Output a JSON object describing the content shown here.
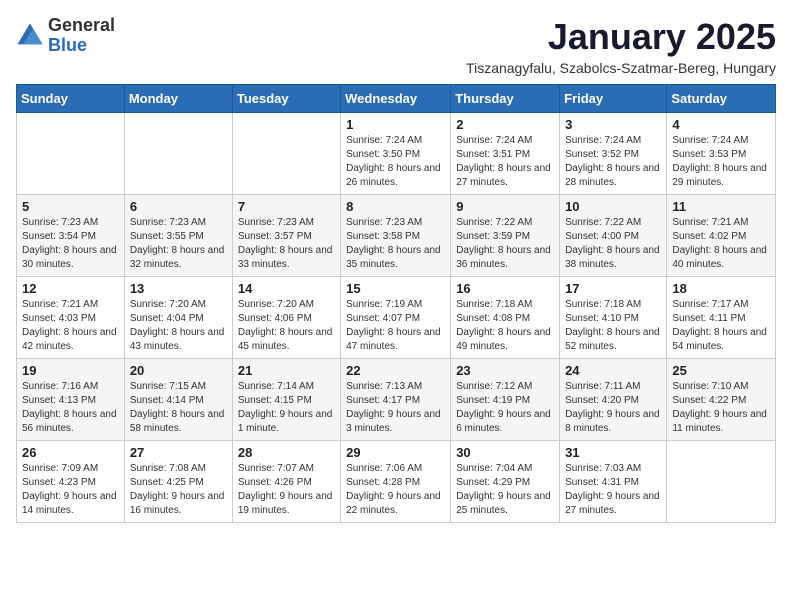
{
  "header": {
    "logo_general": "General",
    "logo_blue": "Blue",
    "month_title": "January 2025",
    "subtitle": "Tiszanagyfalu, Szabolcs-Szatmar-Bereg, Hungary"
  },
  "weekdays": [
    "Sunday",
    "Monday",
    "Tuesday",
    "Wednesday",
    "Thursday",
    "Friday",
    "Saturday"
  ],
  "weeks": [
    [
      {
        "day": null
      },
      {
        "day": null
      },
      {
        "day": null
      },
      {
        "day": 1,
        "sunrise": "Sunrise: 7:24 AM",
        "sunset": "Sunset: 3:50 PM",
        "daylight": "Daylight: 8 hours and 26 minutes."
      },
      {
        "day": 2,
        "sunrise": "Sunrise: 7:24 AM",
        "sunset": "Sunset: 3:51 PM",
        "daylight": "Daylight: 8 hours and 27 minutes."
      },
      {
        "day": 3,
        "sunrise": "Sunrise: 7:24 AM",
        "sunset": "Sunset: 3:52 PM",
        "daylight": "Daylight: 8 hours and 28 minutes."
      },
      {
        "day": 4,
        "sunrise": "Sunrise: 7:24 AM",
        "sunset": "Sunset: 3:53 PM",
        "daylight": "Daylight: 8 hours and 29 minutes."
      }
    ],
    [
      {
        "day": 5,
        "sunrise": "Sunrise: 7:23 AM",
        "sunset": "Sunset: 3:54 PM",
        "daylight": "Daylight: 8 hours and 30 minutes."
      },
      {
        "day": 6,
        "sunrise": "Sunrise: 7:23 AM",
        "sunset": "Sunset: 3:55 PM",
        "daylight": "Daylight: 8 hours and 32 minutes."
      },
      {
        "day": 7,
        "sunrise": "Sunrise: 7:23 AM",
        "sunset": "Sunset: 3:57 PM",
        "daylight": "Daylight: 8 hours and 33 minutes."
      },
      {
        "day": 8,
        "sunrise": "Sunrise: 7:23 AM",
        "sunset": "Sunset: 3:58 PM",
        "daylight": "Daylight: 8 hours and 35 minutes."
      },
      {
        "day": 9,
        "sunrise": "Sunrise: 7:22 AM",
        "sunset": "Sunset: 3:59 PM",
        "daylight": "Daylight: 8 hours and 36 minutes."
      },
      {
        "day": 10,
        "sunrise": "Sunrise: 7:22 AM",
        "sunset": "Sunset: 4:00 PM",
        "daylight": "Daylight: 8 hours and 38 minutes."
      },
      {
        "day": 11,
        "sunrise": "Sunrise: 7:21 AM",
        "sunset": "Sunset: 4:02 PM",
        "daylight": "Daylight: 8 hours and 40 minutes."
      }
    ],
    [
      {
        "day": 12,
        "sunrise": "Sunrise: 7:21 AM",
        "sunset": "Sunset: 4:03 PM",
        "daylight": "Daylight: 8 hours and 42 minutes."
      },
      {
        "day": 13,
        "sunrise": "Sunrise: 7:20 AM",
        "sunset": "Sunset: 4:04 PM",
        "daylight": "Daylight: 8 hours and 43 minutes."
      },
      {
        "day": 14,
        "sunrise": "Sunrise: 7:20 AM",
        "sunset": "Sunset: 4:06 PM",
        "daylight": "Daylight: 8 hours and 45 minutes."
      },
      {
        "day": 15,
        "sunrise": "Sunrise: 7:19 AM",
        "sunset": "Sunset: 4:07 PM",
        "daylight": "Daylight: 8 hours and 47 minutes."
      },
      {
        "day": 16,
        "sunrise": "Sunrise: 7:18 AM",
        "sunset": "Sunset: 4:08 PM",
        "daylight": "Daylight: 8 hours and 49 minutes."
      },
      {
        "day": 17,
        "sunrise": "Sunrise: 7:18 AM",
        "sunset": "Sunset: 4:10 PM",
        "daylight": "Daylight: 8 hours and 52 minutes."
      },
      {
        "day": 18,
        "sunrise": "Sunrise: 7:17 AM",
        "sunset": "Sunset: 4:11 PM",
        "daylight": "Daylight: 8 hours and 54 minutes."
      }
    ],
    [
      {
        "day": 19,
        "sunrise": "Sunrise: 7:16 AM",
        "sunset": "Sunset: 4:13 PM",
        "daylight": "Daylight: 8 hours and 56 minutes."
      },
      {
        "day": 20,
        "sunrise": "Sunrise: 7:15 AM",
        "sunset": "Sunset: 4:14 PM",
        "daylight": "Daylight: 8 hours and 58 minutes."
      },
      {
        "day": 21,
        "sunrise": "Sunrise: 7:14 AM",
        "sunset": "Sunset: 4:15 PM",
        "daylight": "Daylight: 9 hours and 1 minute."
      },
      {
        "day": 22,
        "sunrise": "Sunrise: 7:13 AM",
        "sunset": "Sunset: 4:17 PM",
        "daylight": "Daylight: 9 hours and 3 minutes."
      },
      {
        "day": 23,
        "sunrise": "Sunrise: 7:12 AM",
        "sunset": "Sunset: 4:19 PM",
        "daylight": "Daylight: 9 hours and 6 minutes."
      },
      {
        "day": 24,
        "sunrise": "Sunrise: 7:11 AM",
        "sunset": "Sunset: 4:20 PM",
        "daylight": "Daylight: 9 hours and 8 minutes."
      },
      {
        "day": 25,
        "sunrise": "Sunrise: 7:10 AM",
        "sunset": "Sunset: 4:22 PM",
        "daylight": "Daylight: 9 hours and 11 minutes."
      }
    ],
    [
      {
        "day": 26,
        "sunrise": "Sunrise: 7:09 AM",
        "sunset": "Sunset: 4:23 PM",
        "daylight": "Daylight: 9 hours and 14 minutes."
      },
      {
        "day": 27,
        "sunrise": "Sunrise: 7:08 AM",
        "sunset": "Sunset: 4:25 PM",
        "daylight": "Daylight: 9 hours and 16 minutes."
      },
      {
        "day": 28,
        "sunrise": "Sunrise: 7:07 AM",
        "sunset": "Sunset: 4:26 PM",
        "daylight": "Daylight: 9 hours and 19 minutes."
      },
      {
        "day": 29,
        "sunrise": "Sunrise: 7:06 AM",
        "sunset": "Sunset: 4:28 PM",
        "daylight": "Daylight: 9 hours and 22 minutes."
      },
      {
        "day": 30,
        "sunrise": "Sunrise: 7:04 AM",
        "sunset": "Sunset: 4:29 PM",
        "daylight": "Daylight: 9 hours and 25 minutes."
      },
      {
        "day": 31,
        "sunrise": "Sunrise: 7:03 AM",
        "sunset": "Sunset: 4:31 PM",
        "daylight": "Daylight: 9 hours and 27 minutes."
      },
      {
        "day": null
      }
    ]
  ]
}
